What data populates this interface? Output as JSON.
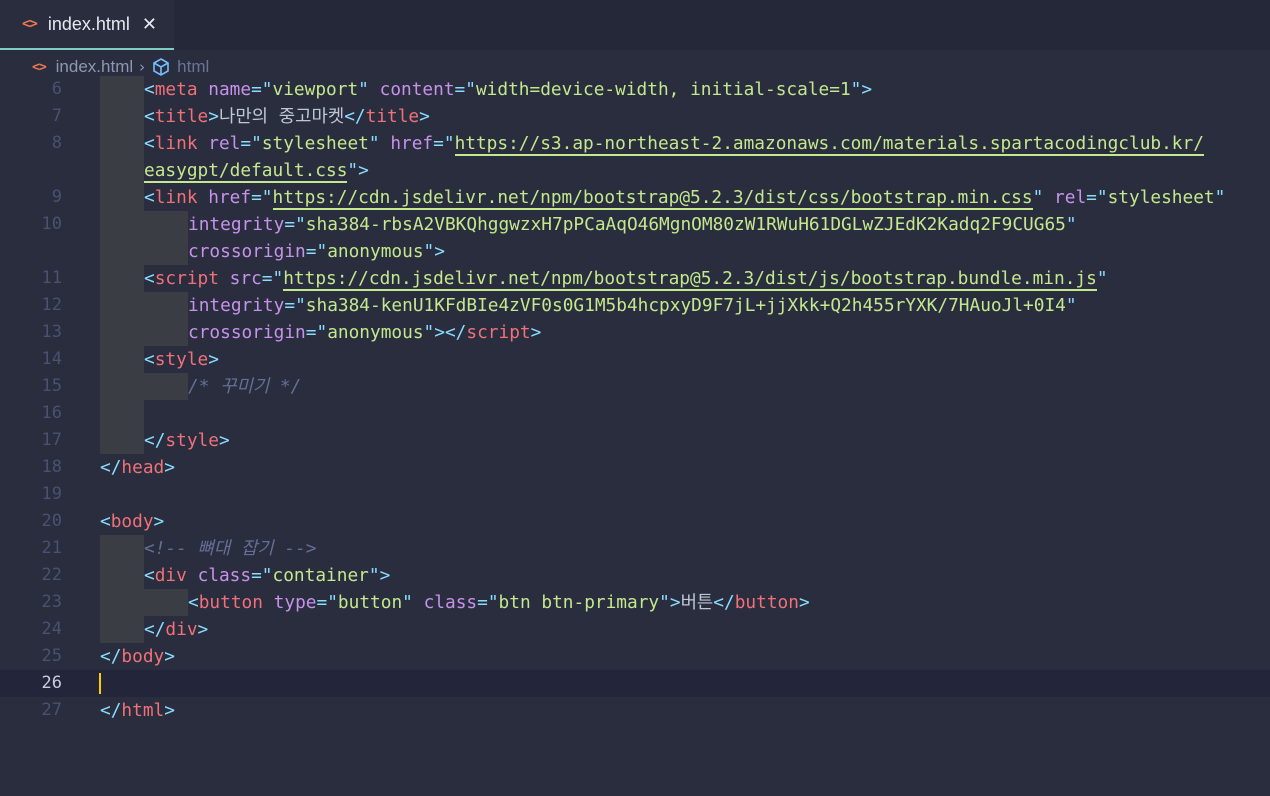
{
  "tab": {
    "icon": "code-brackets-icon",
    "title": "index.html",
    "close": "✕"
  },
  "breadcrumb": {
    "icon": "code-brackets-icon",
    "file": "index.html",
    "separator": "›",
    "symbol_icon": "cube-symbol-icon",
    "symbol": "html"
  },
  "editor": {
    "current_line": 26,
    "lines": [
      {
        "n": "6",
        "indent": 1,
        "t": [
          [
            "p",
            "<"
          ],
          [
            "t",
            "meta"
          ],
          [
            "x",
            " "
          ],
          [
            "a",
            "name"
          ],
          [
            "p",
            "=\""
          ],
          [
            "s",
            "viewport"
          ],
          [
            "p",
            "\""
          ],
          [
            "x",
            " "
          ],
          [
            "a",
            "content"
          ],
          [
            "p",
            "=\""
          ],
          [
            "s",
            "width=device-width, initial-scale=1"
          ],
          [
            "p",
            "\">"
          ]
        ]
      },
      {
        "n": "7",
        "indent": 1,
        "t": [
          [
            "p",
            "<"
          ],
          [
            "t",
            "title"
          ],
          [
            "p",
            ">"
          ],
          [
            "x",
            "나만의 중고마켓"
          ],
          [
            "p",
            "</"
          ],
          [
            "t",
            "title"
          ],
          [
            "p",
            ">"
          ]
        ]
      },
      {
        "n": "8",
        "indent": 1,
        "t": [
          [
            "p",
            "<"
          ],
          [
            "t",
            "link"
          ],
          [
            "x",
            " "
          ],
          [
            "a",
            "rel"
          ],
          [
            "p",
            "=\""
          ],
          [
            "s",
            "stylesheet"
          ],
          [
            "p",
            "\""
          ],
          [
            "x",
            " "
          ],
          [
            "a",
            "href"
          ],
          [
            "p",
            "=\""
          ],
          [
            "u",
            "https://s3.ap-northeast-2.amazonaws.com/materials.spartacodingclub.kr/"
          ]
        ]
      },
      {
        "n": "",
        "indent": 1,
        "t": [
          [
            "u",
            "easygpt/default.css"
          ],
          [
            "p",
            "\">"
          ]
        ]
      },
      {
        "n": "9",
        "indent": 1,
        "t": [
          [
            "p",
            "<"
          ],
          [
            "t",
            "link"
          ],
          [
            "x",
            " "
          ],
          [
            "a",
            "href"
          ],
          [
            "p",
            "=\""
          ],
          [
            "u",
            "https://cdn.jsdelivr.net/npm/bootstrap@5.2.3/dist/css/bootstrap.min.css"
          ],
          [
            "p",
            "\""
          ],
          [
            "x",
            " "
          ],
          [
            "a",
            "rel"
          ],
          [
            "p",
            "=\""
          ],
          [
            "s",
            "stylesheet"
          ],
          [
            "p",
            "\""
          ]
        ]
      },
      {
        "n": "10",
        "indent": 2,
        "t": [
          [
            "a",
            "integrity"
          ],
          [
            "p",
            "=\""
          ],
          [
            "s",
            "sha384-rbsA2VBKQhggwzxH7pPCaAqO46MgnOM80zW1RWuH61DGLwZJEdK2Kadq2F9CUG65"
          ],
          [
            "p",
            "\""
          ]
        ]
      },
      {
        "n": "",
        "indent": 2,
        "t": [
          [
            "a",
            "crossorigin"
          ],
          [
            "p",
            "=\""
          ],
          [
            "s",
            "anonymous"
          ],
          [
            "p",
            "\">"
          ]
        ]
      },
      {
        "n": "11",
        "indent": 1,
        "t": [
          [
            "p",
            "<"
          ],
          [
            "t",
            "script"
          ],
          [
            "x",
            " "
          ],
          [
            "a",
            "src"
          ],
          [
            "p",
            "=\""
          ],
          [
            "u",
            "https://cdn.jsdelivr.net/npm/bootstrap@5.2.3/dist/js/bootstrap.bundle.min.js"
          ],
          [
            "p",
            "\""
          ]
        ]
      },
      {
        "n": "12",
        "indent": 2,
        "t": [
          [
            "a",
            "integrity"
          ],
          [
            "p",
            "=\""
          ],
          [
            "s",
            "sha384-kenU1KFdBIe4zVF0s0G1M5b4hcpxyD9F7jL+jjXkk+Q2h455rYXK/7HAuoJl+0I4"
          ],
          [
            "p",
            "\""
          ]
        ]
      },
      {
        "n": "13",
        "indent": 2,
        "t": [
          [
            "a",
            "crossorigin"
          ],
          [
            "p",
            "=\""
          ],
          [
            "s",
            "anonymous"
          ],
          [
            "p",
            "\"></"
          ],
          [
            "t",
            "script"
          ],
          [
            "p",
            ">"
          ]
        ]
      },
      {
        "n": "14",
        "indent": 1,
        "t": [
          [
            "p",
            "<"
          ],
          [
            "t",
            "style"
          ],
          [
            "p",
            ">"
          ]
        ]
      },
      {
        "n": "15",
        "indent": 2,
        "t": [
          [
            "c",
            "/* 꾸미기 */"
          ]
        ]
      },
      {
        "n": "16",
        "indent": 1,
        "t": []
      },
      {
        "n": "17",
        "indent": 1,
        "t": [
          [
            "p",
            "</"
          ],
          [
            "t",
            "style"
          ],
          [
            "p",
            ">"
          ]
        ]
      },
      {
        "n": "18",
        "indent": 0,
        "t": [
          [
            "p",
            "</"
          ],
          [
            "t",
            "head"
          ],
          [
            "p",
            ">"
          ]
        ]
      },
      {
        "n": "19",
        "indent": 0,
        "t": []
      },
      {
        "n": "20",
        "indent": 0,
        "t": [
          [
            "p",
            "<"
          ],
          [
            "t",
            "body"
          ],
          [
            "p",
            ">"
          ]
        ]
      },
      {
        "n": "21",
        "indent": 1,
        "t": [
          [
            "c",
            "<!-- 뼈대 잡기 -->"
          ]
        ]
      },
      {
        "n": "22",
        "indent": 1,
        "t": [
          [
            "p",
            "<"
          ],
          [
            "t",
            "div"
          ],
          [
            "x",
            " "
          ],
          [
            "a",
            "class"
          ],
          [
            "p",
            "=\""
          ],
          [
            "s",
            "container"
          ],
          [
            "p",
            "\">"
          ]
        ]
      },
      {
        "n": "23",
        "indent": 2,
        "t": [
          [
            "p",
            "<"
          ],
          [
            "t",
            "button"
          ],
          [
            "x",
            " "
          ],
          [
            "a",
            "type"
          ],
          [
            "p",
            "=\""
          ],
          [
            "s",
            "button"
          ],
          [
            "p",
            "\""
          ],
          [
            "x",
            " "
          ],
          [
            "a",
            "class"
          ],
          [
            "p",
            "=\""
          ],
          [
            "s",
            "btn btn-primary"
          ],
          [
            "p",
            "\">"
          ],
          [
            "x",
            "버튼"
          ],
          [
            "p",
            "</"
          ],
          [
            "t",
            "button"
          ],
          [
            "p",
            ">"
          ]
        ]
      },
      {
        "n": "24",
        "indent": 1,
        "t": [
          [
            "p",
            "</"
          ],
          [
            "t",
            "div"
          ],
          [
            "p",
            ">"
          ]
        ]
      },
      {
        "n": "25",
        "indent": 0,
        "t": [
          [
            "p",
            "</"
          ],
          [
            "t",
            "body"
          ],
          [
            "p",
            ">"
          ]
        ]
      },
      {
        "n": "26",
        "indent": 0,
        "t": []
      },
      {
        "n": "27",
        "indent": 0,
        "t": [
          [
            "p",
            "</"
          ],
          [
            "t",
            "html"
          ],
          [
            "p",
            ">"
          ]
        ]
      }
    ]
  }
}
